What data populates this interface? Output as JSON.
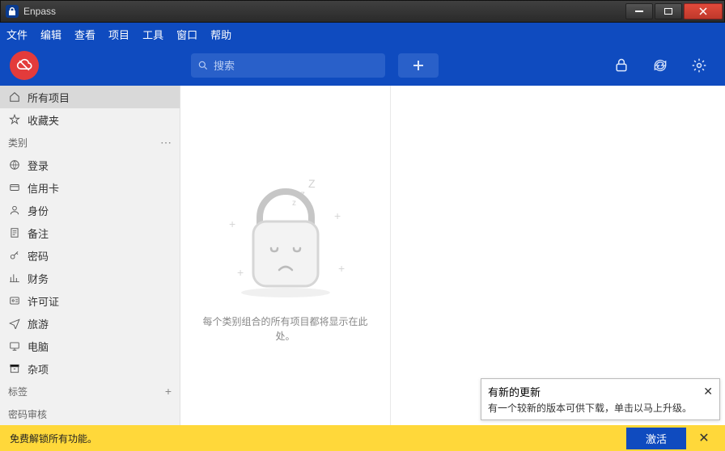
{
  "window": {
    "title": "Enpass"
  },
  "menu": {
    "file": "文件",
    "edit": "编辑",
    "view": "查看",
    "item": "项目",
    "tools": "工具",
    "window": "窗口",
    "help": "帮助"
  },
  "toolbar": {
    "search_placeholder": "搜索"
  },
  "sidebar": {
    "all_items": "所有项目",
    "favorites": "收藏夹",
    "categories_label": "类别",
    "categories": {
      "login": "登录",
      "credit_card": "信用卡",
      "identity": "身份",
      "note": "备注",
      "password": "密码",
      "finance": "财务",
      "license": "许可证",
      "travel": "旅游",
      "computer": "电脑",
      "misc": "杂项"
    },
    "tags_label": "标签",
    "audit_label": "密码审核"
  },
  "empty": {
    "message": "每个类别组合的所有项目都将显示在此处。"
  },
  "update": {
    "title": "有新的更新",
    "body": "有一个较新的版本可供下载，单击以马上升级。"
  },
  "bottom": {
    "message": "免费解锁所有功能。",
    "activate": "激活"
  }
}
